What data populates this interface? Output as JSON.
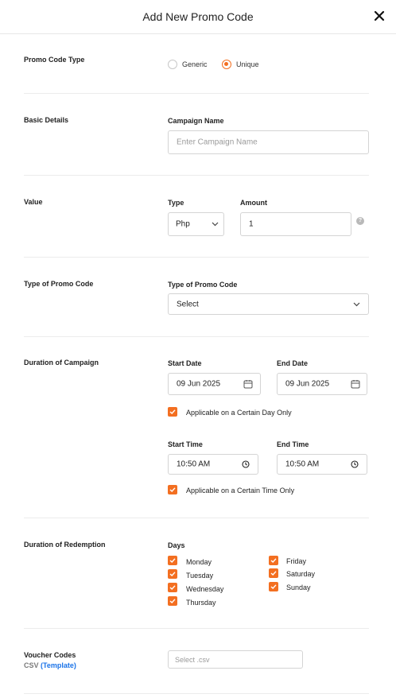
{
  "header": {
    "title": "Add New Promo Code"
  },
  "promo_type": {
    "section": "Promo Code Type",
    "options": [
      {
        "label": "Generic",
        "selected": false
      },
      {
        "label": "Unique",
        "selected": true
      }
    ]
  },
  "basic": {
    "section": "Basic Details",
    "campaign_label": "Campaign Name",
    "campaign_placeholder": "Enter Campaign Name"
  },
  "value": {
    "section": "Value",
    "type_label": "Type",
    "type_value": "Php",
    "amount_label": "Amount",
    "amount_value": "1",
    "help_icon": "?"
  },
  "promo_kind": {
    "section": "Type of Promo Code",
    "label": "Type of Promo Code",
    "select_value": "Select"
  },
  "duration": {
    "section": "Duration of Campaign",
    "start_date_label": "Start Date",
    "start_date": "09 Jun 2025",
    "end_date_label": "End Date",
    "end_date": "09 Jun 2025",
    "certain_day": "Applicable on a Certain Day Only",
    "start_time_label": "Start Time",
    "start_time": "10:50  AM",
    "end_time_label": "End Time",
    "end_time": "10:50  AM",
    "certain_time": "Applicable on a Certain Time Only"
  },
  "redemption": {
    "section": "Duration of Redemption",
    "days_label": "Days",
    "days_col1": [
      "Monday",
      "Tuesday",
      "Wednesday",
      "Thursday"
    ],
    "days_col2": [
      "Friday",
      "Saturday",
      "Sunday"
    ]
  },
  "voucher": {
    "section": "Voucher Codes",
    "csv_label": "CSV",
    "template_link": "(Template)",
    "file_placeholder": "Select .csv"
  },
  "colors": {
    "accent": "#f36f21",
    "link": "#1a73e8"
  }
}
